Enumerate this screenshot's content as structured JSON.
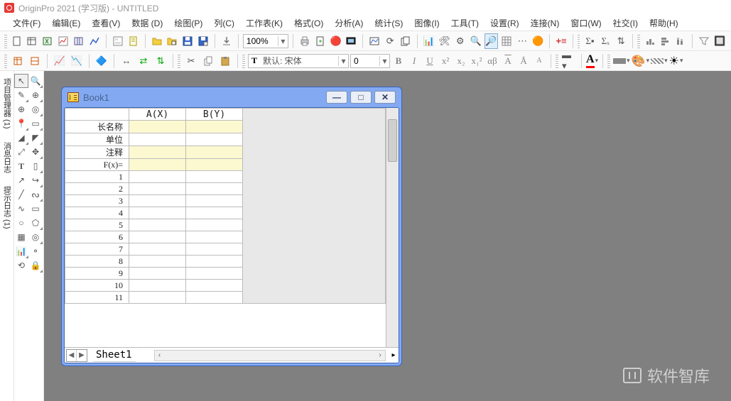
{
  "title": "OriginPro 2021 (学习版) - UNTITLED",
  "menu": [
    "文件(F)",
    "编辑(E)",
    "查看(V)",
    "数据 (D)",
    "绘图(P)",
    "列(C)",
    "工作表(K)",
    "格式(O)",
    "分析(A)",
    "统计(S)",
    "图像(I)",
    "工具(T)",
    "设置(R)",
    "连接(N)",
    "窗口(W)",
    "社交(I)",
    "帮助(H)"
  ],
  "zoom": "100%",
  "font": {
    "name": "默认: 宋体",
    "size": "0"
  },
  "fmt_buttons": [
    "B",
    "I",
    "U",
    "x²",
    "x₂",
    "x₁²",
    "αβ",
    "A",
    "Å",
    "A"
  ],
  "left_labels": [
    "项目管理器 (1)",
    "消息日志",
    "提示日志 (1)"
  ],
  "book": {
    "title": "Book1",
    "cols": [
      "A(X)",
      "B(Y)"
    ],
    "row_labels": [
      "长名称",
      "单位",
      "注释",
      "F(x)="
    ],
    "rows": [
      1,
      2,
      3,
      4,
      5,
      6,
      7,
      8,
      9,
      10,
      11
    ],
    "sheet": "Sheet1"
  },
  "watermark": "软件智库"
}
